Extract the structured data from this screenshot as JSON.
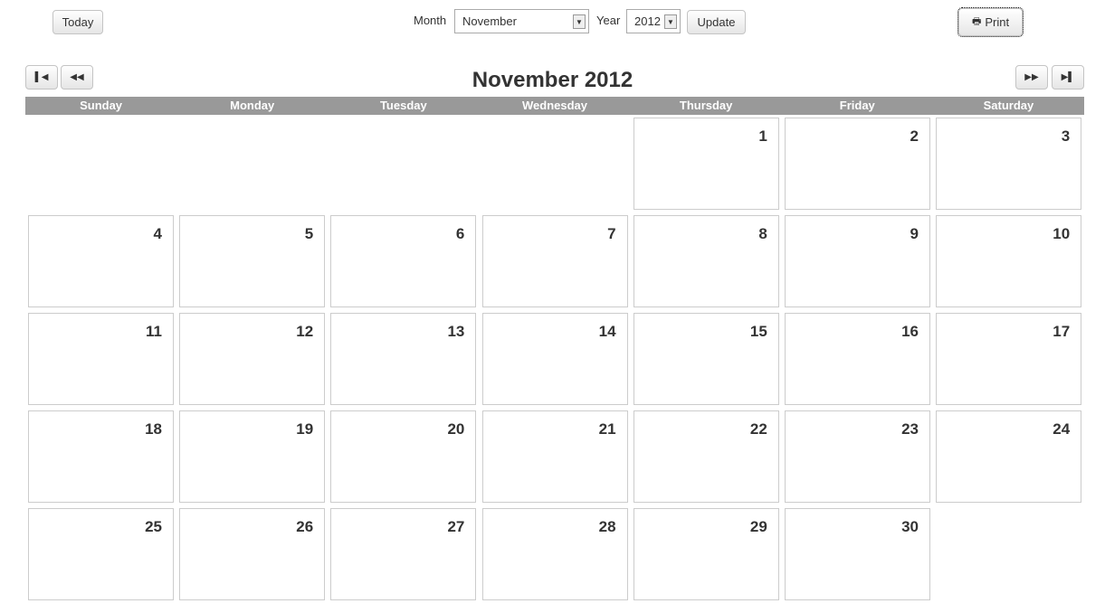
{
  "toolbar": {
    "today": "Today",
    "month_label": "Month",
    "month_value": "November",
    "year_label": "Year",
    "year_value": "2012",
    "update": "Update",
    "print": "Print"
  },
  "title": "November 2012",
  "weekdays": [
    "Sunday",
    "Monday",
    "Tuesday",
    "Wednesday",
    "Thursday",
    "Friday",
    "Saturday"
  ],
  "weeks": [
    [
      null,
      null,
      null,
      null,
      "1",
      "2",
      "3"
    ],
    [
      "4",
      "5",
      "6",
      "7",
      "8",
      "9",
      "10"
    ],
    [
      "11",
      "12",
      "13",
      "14",
      "15",
      "16",
      "17"
    ],
    [
      "18",
      "19",
      "20",
      "21",
      "22",
      "23",
      "24"
    ],
    [
      "25",
      "26",
      "27",
      "28",
      "29",
      "30",
      null
    ]
  ]
}
